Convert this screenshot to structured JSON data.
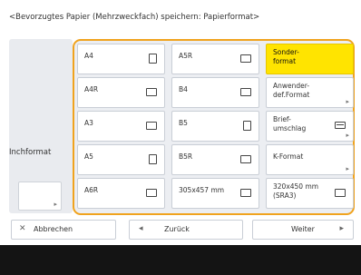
{
  "screen": {
    "title": "<Bevorzugtes Papier (Mehrzweckfach) speichern: Papierformat>"
  },
  "left": {
    "label": "Inchformat"
  },
  "sizes": [
    {
      "label": "A4",
      "icon": "portrait-paper-icon"
    },
    {
      "label": "A5R",
      "icon": "landscape-paper-icon"
    },
    {
      "label": "Sonder-\nformat",
      "selected": true
    },
    {
      "label": "A4R",
      "icon": "landscape-paper-icon"
    },
    {
      "label": "B4",
      "icon": "landscape-paper-icon"
    },
    {
      "label": "Anwender-\ndef.Format"
    },
    {
      "label": "A3",
      "icon": "landscape-paper-icon"
    },
    {
      "label": "B5",
      "icon": "portrait-paper-icon"
    },
    {
      "label": "Brief-\numschlag",
      "icon": "envelope-icon"
    },
    {
      "label": "A5",
      "icon": "portrait-paper-icon"
    },
    {
      "label": "B5R",
      "icon": "landscape-paper-icon"
    },
    {
      "label": "K-Format"
    },
    {
      "label": "A6R",
      "icon": "landscape-paper-icon"
    },
    {
      "label": "305x457 mm",
      "icon": "landscape-paper-icon"
    },
    {
      "label": "320x450 mm\n(SRA3)",
      "icon": "landscape-paper-icon"
    }
  ],
  "footer_buttons": {
    "cancel": {
      "label": "Abbrechen",
      "icon": "close-icon"
    },
    "back": {
      "label": "Zurück",
      "icon": "previous-arrow-icon"
    },
    "next": {
      "label": "Weiter",
      "icon": "next-arrow-icon"
    }
  },
  "colors": {
    "accent": "#f0a31e",
    "selected": "#ffe400",
    "footer": "#141414"
  }
}
